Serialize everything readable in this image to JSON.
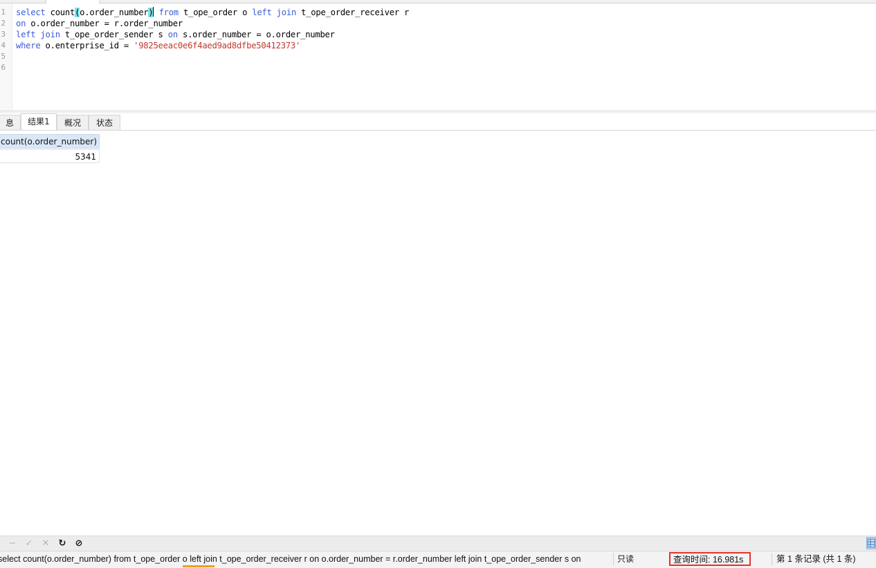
{
  "editor": {
    "line_numbers": [
      "1",
      "2",
      "3",
      "4",
      "5",
      "6"
    ],
    "lines": [
      [
        {
          "t": "select",
          "c": "kw"
        },
        {
          "t": " count"
        },
        {
          "t": "(",
          "c": "bracket"
        },
        {
          "t": "o.order_number"
        },
        {
          "t": ")",
          "c": "bracket"
        },
        {
          "t": "",
          "c": "caret"
        },
        {
          "t": " "
        },
        {
          "t": "from",
          "c": "kw"
        },
        {
          "t": " t_ope_order o "
        },
        {
          "t": "left join",
          "c": "kw"
        },
        {
          "t": " t_ope_order_receiver r"
        }
      ],
      [
        {
          "t": "on",
          "c": "kw"
        },
        {
          "t": " o.order_number = r.order_number"
        }
      ],
      [
        {
          "t": "left join",
          "c": "kw"
        },
        {
          "t": " t_ope_order_sender s "
        },
        {
          "t": "on",
          "c": "kw"
        },
        {
          "t": " s.order_number = o.order_number"
        }
      ],
      [
        {
          "t": "where",
          "c": "kw"
        },
        {
          "t": " o.enterprise_id = "
        },
        {
          "t": "'9825eeac0e6f4aed9ad8dfbe50412373'",
          "c": "str"
        }
      ],
      [],
      []
    ]
  },
  "result_tabs": [
    {
      "label": "信息",
      "visible": "息"
    },
    {
      "label": "结果1"
    },
    {
      "label": "概况"
    },
    {
      "label": "状态"
    }
  ],
  "result_grid": {
    "columns": [
      "count(o.order_number)"
    ],
    "rows": [
      [
        "5341"
      ]
    ]
  },
  "toolbar": {
    "icons": [
      "minus-icon",
      "check-icon",
      "close-icon",
      "refresh-icon",
      "stop-icon"
    ],
    "glyphs": [
      "−",
      "✓",
      "✕",
      "↻",
      "⊘"
    ]
  },
  "status_bar": {
    "query_text": "select count(o.order_number) from t_ope_order o left join t_ope_order_receiver r  on o.order_number = r.order_number left join t_ope_order_sender s on",
    "mode": "只读",
    "query_time": "查询时间: 16.981s",
    "records": "第 1 条记录 (共 1 条)"
  },
  "colors": {
    "keyword": "#3b5bd9",
    "string": "#c0392b",
    "bracket_match": "#7fe3ec",
    "grid_header": "#d9e8f7",
    "highlight_box": "#e0322e"
  }
}
